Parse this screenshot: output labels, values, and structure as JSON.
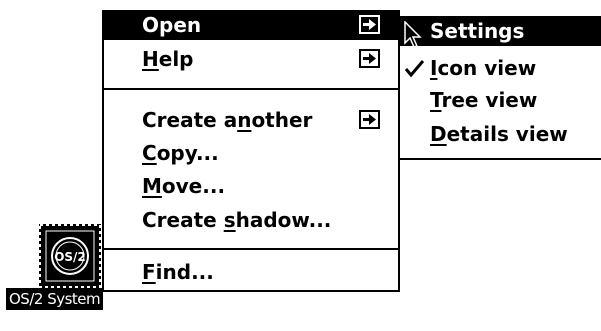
{
  "context_menu": {
    "items": [
      {
        "pre": "",
        "key": "",
        "post": "Open",
        "has_submenu": true,
        "selected": true
      },
      {
        "pre": "",
        "key": "H",
        "post": "elp",
        "has_submenu": true,
        "selected": false
      },
      {
        "pre": "Create a",
        "key": "n",
        "post": "other",
        "has_submenu": true,
        "selected": false
      },
      {
        "pre": "",
        "key": "C",
        "post": "opy...",
        "has_submenu": false,
        "selected": false
      },
      {
        "pre": "",
        "key": "M",
        "post": "ove...",
        "has_submenu": false,
        "selected": false
      },
      {
        "pre": "Create ",
        "key": "s",
        "post": "hadow...",
        "has_submenu": false,
        "selected": false
      },
      {
        "pre": "",
        "key": "F",
        "post": "ind...",
        "has_submenu": false,
        "selected": false
      }
    ]
  },
  "open_submenu": {
    "items": [
      {
        "pre": "",
        "key": "",
        "post": "Settings",
        "checked": false,
        "selected": true
      },
      {
        "pre": "",
        "key": "I",
        "post": "con view",
        "checked": true,
        "selected": false
      },
      {
        "pre": "",
        "key": "T",
        "post": "ree view",
        "checked": false,
        "selected": false
      },
      {
        "pre": "",
        "key": "D",
        "post": "etails view",
        "checked": false,
        "selected": false
      }
    ]
  },
  "desktop_icon": {
    "label": "OS/2 System",
    "emblem_text": "OS/2",
    "icon": "os2-system-folder-icon"
  },
  "icons": {
    "submenu_arrow": "arrow-right-icon",
    "check": "checkmark-icon",
    "pointer": "mouse-pointer-icon"
  },
  "colors": {
    "highlight": "#000000",
    "highlight_text": "#ffffff",
    "menu_background": "#ffffff"
  }
}
